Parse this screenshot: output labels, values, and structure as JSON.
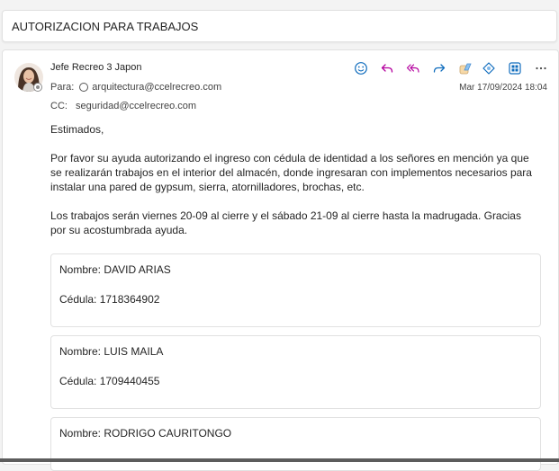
{
  "subject": "AUTORIZACION PARA TRABAJOS",
  "message": {
    "sender": "Jefe Recreo 3 Japon",
    "to_label": "Para:",
    "to": "arquitectura@ccelrecreo.com",
    "cc_label": "CC:",
    "cc": "seguridad@ccelrecreo.com",
    "date": "Mar 17/09/2024 18:04",
    "toolbar": {
      "icons": [
        "emoji-icon",
        "reply-icon",
        "reply-all-icon",
        "forward-icon",
        "copilot-icon",
        "loop-icon",
        "apps-icon",
        "more-icon"
      ]
    },
    "body": {
      "greeting": "Estimados,",
      "paragraph1": "Por favor su ayuda autorizando el ingreso con cédula de identidad a los señores en mención ya que se realizarán trabajos en el interior del almacén, donde ingresaran con implementos necesarios para instalar una pared de gypsum, sierra, atornilladores, brochas, etc.",
      "paragraph2": "Los trabajos serán viernes 20-09 al cierre y el sábado 21-09 al cierre hasta la madrugada. Gracias por su acostumbrada ayuda."
    },
    "people": [
      {
        "name": "Nombre: DAVID ARIAS",
        "id": "Cédula: 1718364902"
      },
      {
        "name": "Nombre: LUIS MAILA",
        "id": "Cédula: 1709440455"
      },
      {
        "name": "Nombre: RODRIGO CAURITONGO",
        "id": ""
      }
    ]
  },
  "colors": {
    "accent": "#0f6cbd",
    "background": "#f3f3f3",
    "card": "#ffffff",
    "border": "#e1e1e1"
  }
}
